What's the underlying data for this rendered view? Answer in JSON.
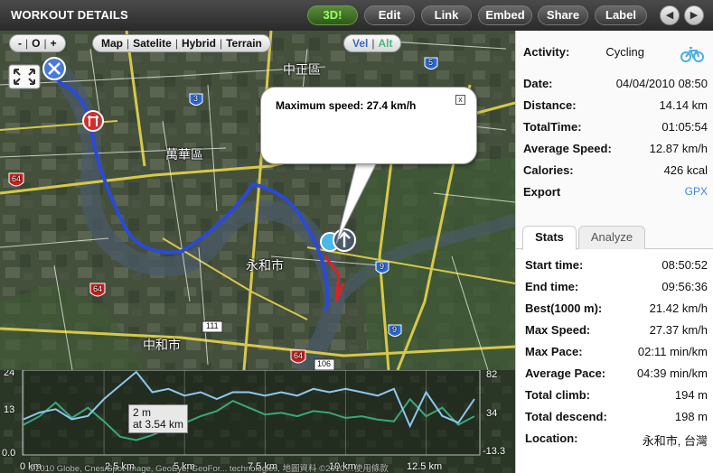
{
  "header": {
    "title": "WORKOUT DETAILS",
    "buttons": {
      "three_d": "3D!",
      "edit": "Edit",
      "link": "Link",
      "embed": "Embed",
      "share": "Share",
      "label": "Label"
    },
    "prev": "◀",
    "next": "▶"
  },
  "map_controls": {
    "zoom_out": "-",
    "zoom_reset": "O",
    "zoom_in": "+",
    "map_types": {
      "map": "Map",
      "satellite": "Satelite",
      "hybrid": "Hybrid",
      "terrain": "Terrain"
    },
    "graph_modes": {
      "vel": "Vel",
      "alt": "Alt"
    }
  },
  "map_labels": {
    "zhongzheng": "中正區",
    "wanhua": "萬華區",
    "yonghe": "永和市",
    "zhonghe": "中和市",
    "road_64_a": "64",
    "road_64_b": "64",
    "road_64_c": "64",
    "road_3": "3",
    "road_5": "5",
    "road_9a": "9",
    "road_9b": "9",
    "road_111": "111",
    "road_106": "106"
  },
  "bubble": {
    "text": "Maximum speed: 27.4 km/h",
    "close": "x"
  },
  "chart": {
    "left_axis": [
      "24",
      "13",
      "0.0"
    ],
    "right_axis": [
      "82",
      "34",
      "-13.3"
    ],
    "x_ticks": [
      "0 km",
      "2.5 km",
      "5 km",
      "7.5 km",
      "10 km",
      "12.5 km"
    ],
    "hover_line1": "2 m",
    "hover_line2": "at 3.54 km",
    "footer": "©2010 Globe, Cnes/Spot Image, GeoEye, GeoFor... technologies, 地圖資料 ©2010 ...使用條款"
  },
  "chart_data": {
    "type": "line",
    "x_range": [
      0,
      14.14
    ],
    "series": [
      {
        "values_x": [
          0,
          0.5,
          1,
          1.5,
          2,
          2.5,
          3,
          3.5,
          4,
          4.5,
          5,
          5.5,
          6,
          6.5,
          7,
          7.5,
          8,
          8.5,
          9,
          9.5,
          10,
          10.5,
          11,
          11.5,
          12,
          12.5,
          13,
          13.5,
          14
        ],
        "values_y": [
          10,
          12,
          13,
          10,
          11,
          16,
          20,
          24,
          18,
          19,
          17,
          18,
          16,
          18,
          18,
          17,
          18,
          17,
          19,
          18,
          19,
          18,
          17,
          19,
          8,
          18,
          11,
          9,
          16
        ],
        "ylim": [
          0,
          24
        ]
      },
      {
        "values_x": [
          0,
          0.5,
          1,
          1.5,
          2,
          2.5,
          3,
          3.5,
          4,
          4.5,
          5,
          5.5,
          6,
          6.5,
          7,
          7.5,
          8,
          8.5,
          9,
          9.5,
          10,
          10.5,
          11,
          11.5,
          12,
          12.5,
          13,
          13.5,
          14
        ],
        "values_y": [
          20,
          30,
          46,
          28,
          40,
          24,
          6,
          2,
          8,
          16,
          22,
          30,
          36,
          48,
          40,
          32,
          34,
          30,
          36,
          34,
          28,
          30,
          26,
          24,
          50,
          30,
          40,
          20,
          30
        ],
        "ylim": [
          -13.3,
          82
        ]
      }
    ]
  },
  "panel": {
    "activity_label": "Activity:",
    "activity_value": "Cycling",
    "date_label": "Date:",
    "date_value": "04/04/2010 08:50",
    "distance_label": "Distance:",
    "distance_value": "14.14 km",
    "totaltime_label": "TotalTime:",
    "totaltime_value": "01:05:54",
    "avgspeed_label": "Average Speed:",
    "avgspeed_value": "12.87 km/h",
    "calories_label": "Calories:",
    "calories_value": "426 kcal",
    "export_label": "Export",
    "export_value": "GPX",
    "tab_stats": "Stats",
    "tab_analyze": "Analyze"
  },
  "stats": [
    {
      "label": "Start time:",
      "value": "08:50:52"
    },
    {
      "label": "End time:",
      "value": "09:56:36"
    },
    {
      "label": "Best(1000 m):",
      "value": "21.42 km/h"
    },
    {
      "label": "Max Speed:",
      "value": "27.37 km/h"
    },
    {
      "label": "Max Pace:",
      "value": "02:11 min/km"
    },
    {
      "label": "Average Pace:",
      "value": "04:39 min/km"
    },
    {
      "label": "Total climb:",
      "value": "194 m"
    },
    {
      "label": "Total descend:",
      "value": "198 m"
    },
    {
      "label": "Location:",
      "value": "永和市, 台灣"
    }
  ],
  "colors": {
    "route": "#2a4ad8",
    "speed_line": "#8fc8f0",
    "alt_line": "#3aa878",
    "link": "#3a8ad8"
  }
}
